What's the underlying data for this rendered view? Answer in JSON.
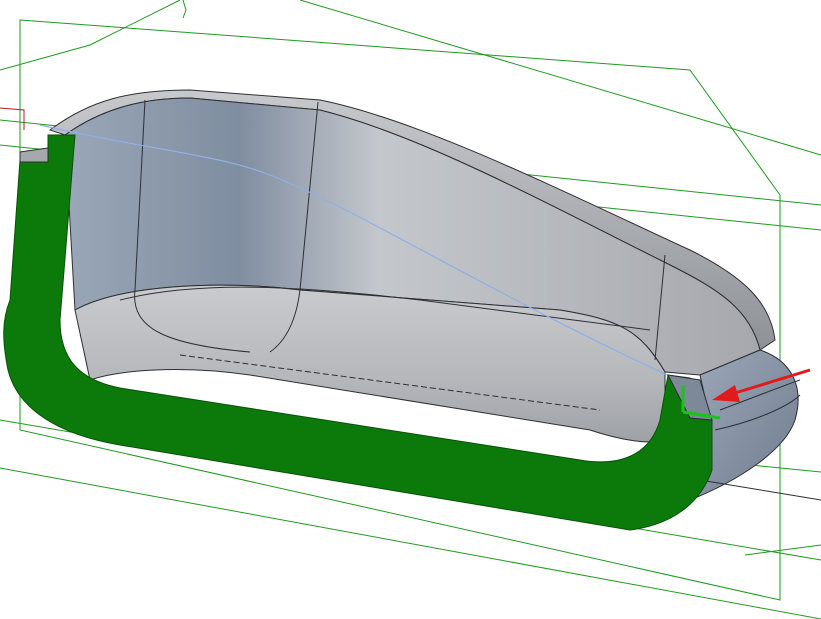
{
  "viewport": {
    "background": "#ffffff",
    "section_color": "#0b7a0b",
    "construction_line_color": "#1a9a1a",
    "body_color": "#a9acb2",
    "edge_color": "#2d2f33",
    "sketch_line_color": "#8fb0e6",
    "annotation_arrow_color": "#e11b1b",
    "triad_color": "#19c419"
  }
}
